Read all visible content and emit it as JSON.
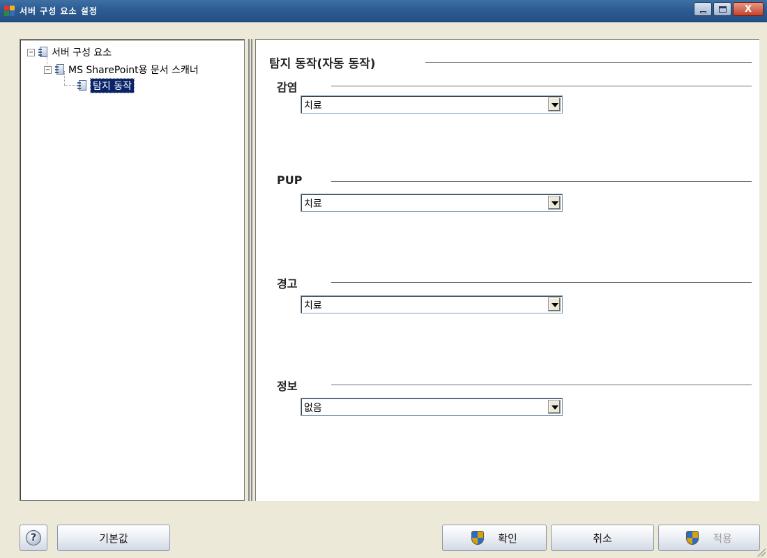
{
  "window": {
    "title": "서버 구성 요소 설정",
    "buttons": [
      "minimize",
      "maximize",
      "close"
    ],
    "close_glyph": "X"
  },
  "tree": {
    "expander_glyph": "−",
    "items": [
      {
        "label": "서버 구성 요소",
        "level": 0,
        "expanded": true
      },
      {
        "label": "MS SharePoint용 문서 스캐너",
        "level": 1,
        "expanded": true
      },
      {
        "label": "탐지 동작",
        "level": 2,
        "selected": true
      }
    ]
  },
  "panel": {
    "title": "탐지 동작(자동 동작)",
    "groups": [
      {
        "label": "감염",
        "value": "치료"
      },
      {
        "label": "PUP",
        "value": "치료"
      },
      {
        "label": "경고",
        "value": "치료"
      },
      {
        "label": "정보",
        "value": "없음"
      }
    ]
  },
  "footer": {
    "help_glyph": "?",
    "default_label": "기본값",
    "ok_label": "확인",
    "cancel_label": "취소",
    "apply_label": "적용",
    "apply_enabled": false
  },
  "colors": {
    "titlebar": "#2d5c92",
    "selection": "#0a246a",
    "dialog_bg": "#ece9d8"
  }
}
